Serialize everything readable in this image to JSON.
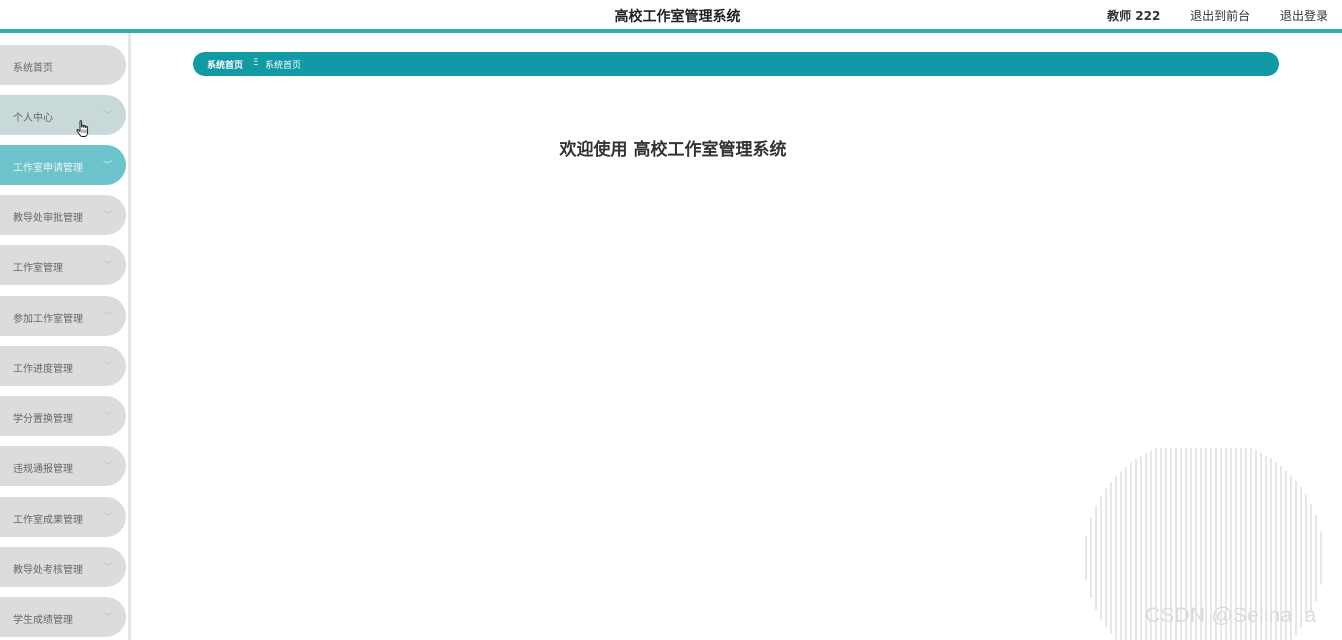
{
  "header": {
    "title": "高校工作室管理系统",
    "user_label": "教师 222",
    "back_to_front": "退出到前台",
    "logout": "退出登录"
  },
  "sidebar": {
    "items": [
      {
        "label": "系统首页",
        "has_chevron": false
      },
      {
        "label": "个人中心",
        "has_chevron": true,
        "state": "hover"
      },
      {
        "label": "工作室申请管理",
        "has_chevron": true,
        "state": "active"
      },
      {
        "label": "教导处审批管理",
        "has_chevron": true
      },
      {
        "label": "工作室管理",
        "has_chevron": true
      },
      {
        "label": "参加工作室管理",
        "has_chevron": true
      },
      {
        "label": "工作进度管理",
        "has_chevron": true
      },
      {
        "label": "学分置换管理",
        "has_chevron": true
      },
      {
        "label": "违规通报管理",
        "has_chevron": true
      },
      {
        "label": "工作室成果管理",
        "has_chevron": true
      },
      {
        "label": "教导处考核管理",
        "has_chevron": true
      },
      {
        "label": "学生成绩管理",
        "has_chevron": true
      }
    ],
    "chevron_glyph": "﹀"
  },
  "breadcrumb": {
    "first": "系统首页",
    "separator": "Ξ",
    "second": "系统首页"
  },
  "main": {
    "welcome_prefix": "欢迎使用",
    "welcome_system": "高校工作室管理系统"
  },
  "watermark": "CSDN @Selina .a",
  "colors": {
    "accent": "#36a9b1",
    "breadcrumb_bg": "#1199a5",
    "menu_bg": "#dcdcdc",
    "menu_active": "#6cc3cc",
    "menu_hover": "#c9d8d9"
  },
  "icons": {
    "cursor": "hand-pointer-icon",
    "chevron": "chevron-down-icon"
  }
}
